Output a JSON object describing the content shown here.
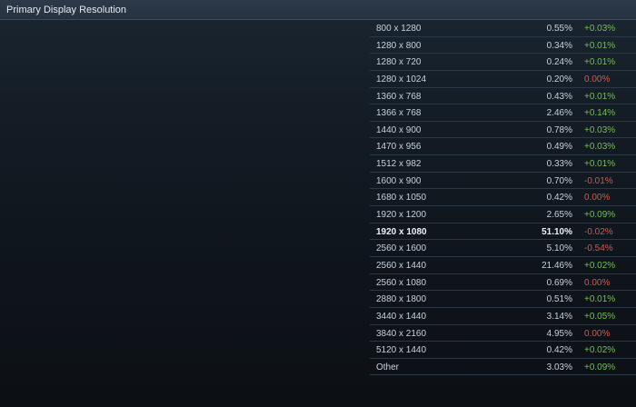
{
  "header": {
    "title": "Primary Display Resolution"
  },
  "colors": {
    "positive": "#6fc14a",
    "negative": "#d5574a"
  },
  "rows": [
    {
      "resolution": "800 x 1280",
      "percent": "0.55%",
      "change": "+0.03%",
      "trend": "up"
    },
    {
      "resolution": "1280 x 800",
      "percent": "0.34%",
      "change": "+0.01%",
      "trend": "up"
    },
    {
      "resolution": "1280 x 720",
      "percent": "0.24%",
      "change": "+0.01%",
      "trend": "up"
    },
    {
      "resolution": "1280 x 1024",
      "percent": "0.20%",
      "change": "0.00%",
      "trend": "down"
    },
    {
      "resolution": "1360 x 768",
      "percent": "0.43%",
      "change": "+0.01%",
      "trend": "up"
    },
    {
      "resolution": "1366 x 768",
      "percent": "2.46%",
      "change": "+0.14%",
      "trend": "up"
    },
    {
      "resolution": "1440 x 900",
      "percent": "0.78%",
      "change": "+0.03%",
      "trend": "up"
    },
    {
      "resolution": "1470 x 956",
      "percent": "0.49%",
      "change": "+0.03%",
      "trend": "up"
    },
    {
      "resolution": "1512 x 982",
      "percent": "0.33%",
      "change": "+0.01%",
      "trend": "up"
    },
    {
      "resolution": "1600 x 900",
      "percent": "0.70%",
      "change": "-0.01%",
      "trend": "down"
    },
    {
      "resolution": "1680 x 1050",
      "percent": "0.42%",
      "change": "0.00%",
      "trend": "down"
    },
    {
      "resolution": "1920 x 1200",
      "percent": "2.65%",
      "change": "+0.09%",
      "trend": "up"
    },
    {
      "resolution": "1920 x 1080",
      "percent": "51.10%",
      "change": "-0.02%",
      "trend": "down",
      "bold": true
    },
    {
      "resolution": "2560 x 1600",
      "percent": "5.10%",
      "change": "-0.54%",
      "trend": "down"
    },
    {
      "resolution": "2560 x 1440",
      "percent": "21.46%",
      "change": "+0.02%",
      "trend": "up"
    },
    {
      "resolution": "2560 x 1080",
      "percent": "0.69%",
      "change": "0.00%",
      "trend": "down"
    },
    {
      "resolution": "2880 x 1800",
      "percent": "0.51%",
      "change": "+0.01%",
      "trend": "up"
    },
    {
      "resolution": "3440 x 1440",
      "percent": "3.14%",
      "change": "+0.05%",
      "trend": "up"
    },
    {
      "resolution": "3840 x 2160",
      "percent": "4.95%",
      "change": "0.00%",
      "trend": "down"
    },
    {
      "resolution": "5120 x 1440",
      "percent": "0.42%",
      "change": "+0.02%",
      "trend": "up"
    },
    {
      "resolution": "Other",
      "percent": "3.03%",
      "change": "+0.09%",
      "trend": "up"
    }
  ]
}
